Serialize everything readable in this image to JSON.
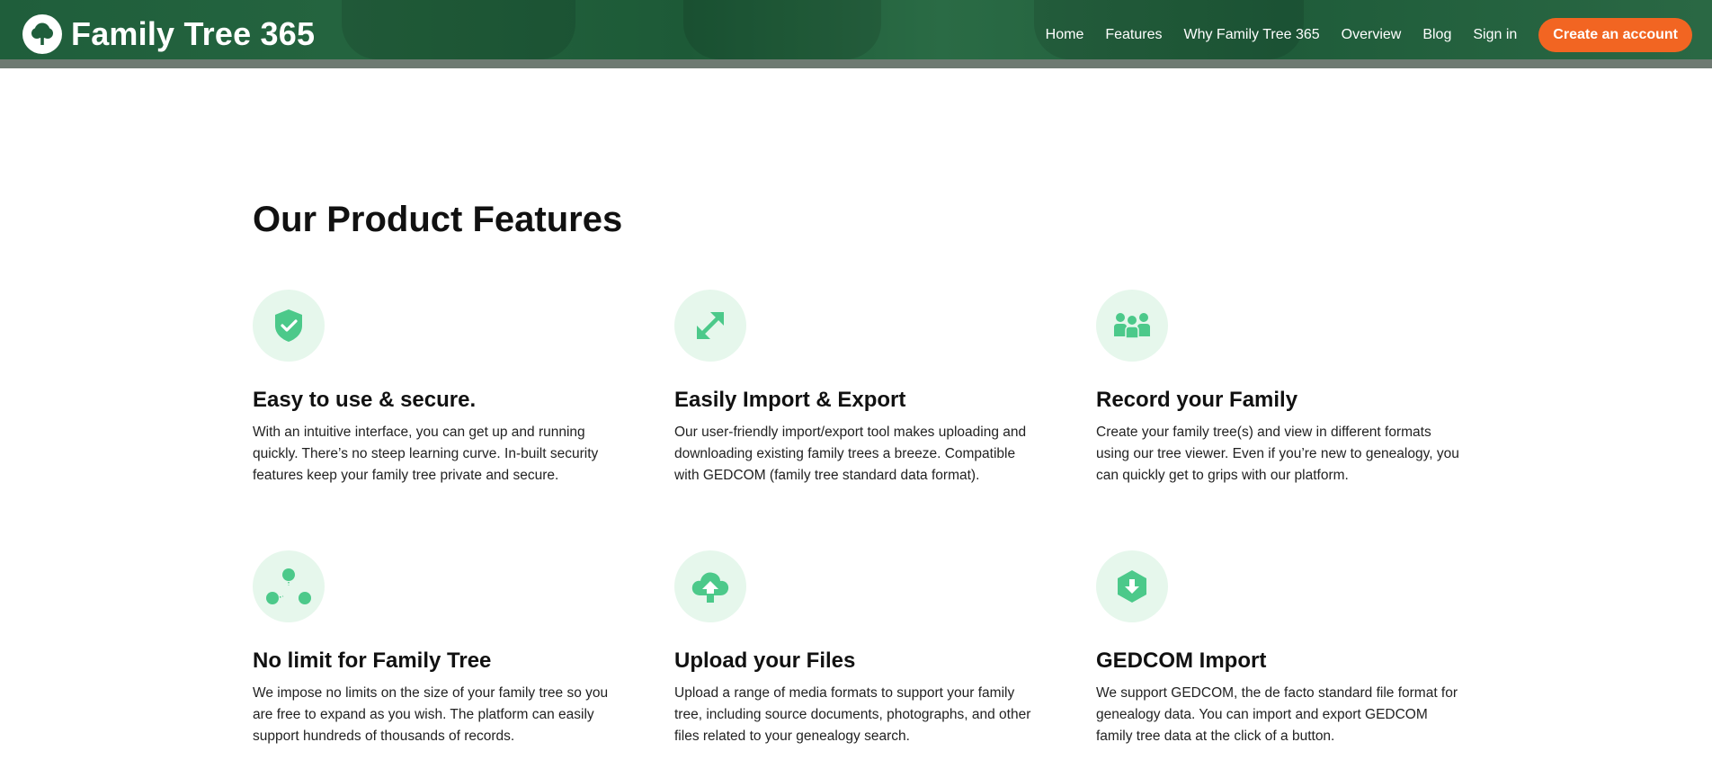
{
  "header": {
    "brand_name": "Family Tree 365",
    "logo_icon": "tree-icon",
    "nav": [
      {
        "label": "Home"
      },
      {
        "label": "Features"
      },
      {
        "label": "Why Family Tree 365"
      },
      {
        "label": "Overview"
      },
      {
        "label": "Blog"
      },
      {
        "label": "Sign in"
      }
    ],
    "cta_label": "Create an account"
  },
  "colors": {
    "header_green": "#1f5e3b",
    "accent_orange": "#f26522",
    "icon_green": "#4cc98a",
    "icon_bg": "#e6f7ec"
  },
  "main": {
    "title": "Our Product Features",
    "features": [
      {
        "icon": "shield-check-icon",
        "title": "Easy to use & secure.",
        "desc": "With an intuitive interface, you can get up and running quickly. There’s no steep learning curve. In-built security features keep your family tree private and secure."
      },
      {
        "icon": "expand-arrows-icon",
        "title": "Easily Import & Export",
        "desc": "Our user-friendly import/export tool makes uploading and downloading existing family trees a breeze. Compatible with GEDCOM (family tree standard data format)."
      },
      {
        "icon": "family-icon",
        "title": "Record your Family",
        "desc": "Create your family tree(s) and view in different formats using our tree viewer. Even if you’re new to genealogy, you can quickly get to grips with our platform."
      },
      {
        "icon": "nodes-icon",
        "title": "No limit for Family Tree",
        "desc": "We impose no limits on the size of your family tree so you are free to expand as you wish. The platform can easily support hundreds of thousands of records."
      },
      {
        "icon": "cloud-upload-icon",
        "title": "Upload your Files",
        "desc": "Upload a range of media formats to support your family tree, including source documents, photographs, and other files related to your genealogy search."
      },
      {
        "icon": "download-badge-icon",
        "title": "GEDCOM Import",
        "desc": "We support GEDCOM, the de facto standard file format for genealogy data. You can import and export GEDCOM family tree data at the click of a button."
      }
    ]
  }
}
